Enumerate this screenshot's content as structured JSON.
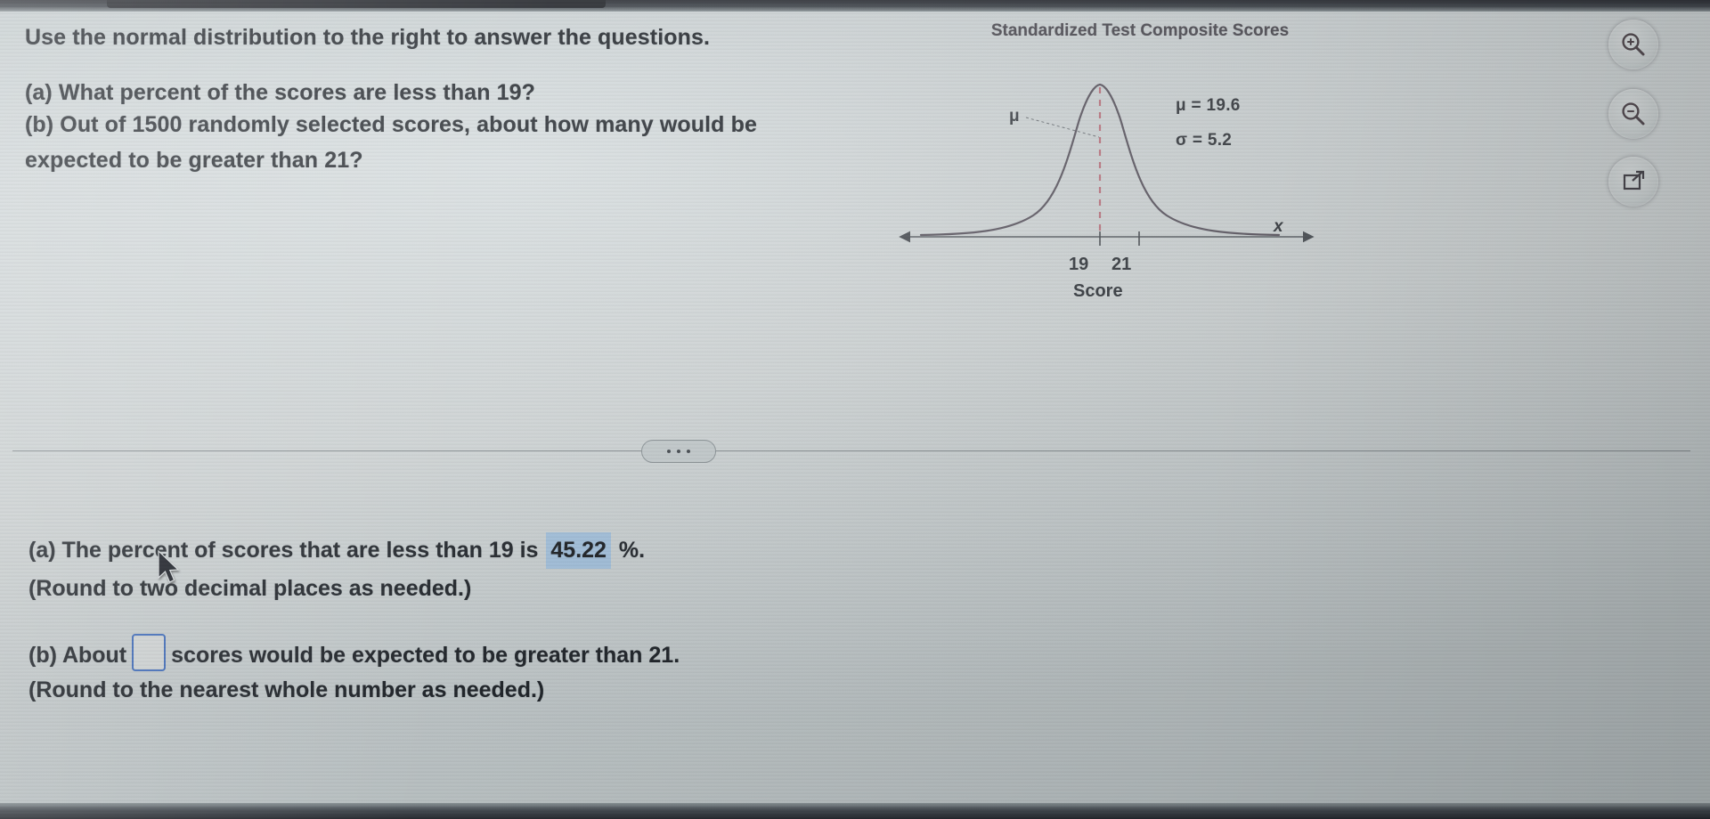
{
  "problem": {
    "stem": "Use the normal distribution to the right to answer the questions.",
    "part_a_question": "(a) What percent of the scores are less than 19?",
    "part_b_question": "(b) Out of 1500 randomly selected scores, about how many would be expected to be greater than 21?"
  },
  "figure": {
    "title": "Standardized Test Composite Scores",
    "mu_marker": "μ",
    "mu_label": "μ = 19.6",
    "sigma_label": "σ = 5.2",
    "tick_19": "19",
    "tick_21": "21",
    "x_axis_name": "Score",
    "x_axis_variable": "x",
    "curve_color": "#5a5560",
    "dashed_line_color": "#c0737f"
  },
  "toolbar": {
    "zoom_in_icon": "magnifier-plus-icon",
    "zoom_out_icon": "magnifier-minus-icon",
    "expand_icon": "pop-out-icon"
  },
  "divider": {
    "more_label": "…"
  },
  "answers": {
    "part_a_prefix": "(a) The percent of scores that are less than 19 is",
    "part_a_value": "45.22",
    "part_a_suffix": "%.",
    "part_a_note": "(Round to two decimal places as needed.)",
    "part_b_prefix": "(b) About",
    "part_b_value": "",
    "part_b_suffix": "scores would be expected to be greater than 21.",
    "part_b_note": "(Round to the nearest whole number as needed.)"
  },
  "chart_data": {
    "type": "line",
    "title": "Standardized Test Composite Scores",
    "xlabel": "Score",
    "ylabel": "",
    "distribution": "normal",
    "mu": 19.6,
    "sigma": 5.2,
    "annotations": [
      {
        "text": "μ = 19.6",
        "type": "parameter"
      },
      {
        "text": "σ = 5.2",
        "type": "parameter"
      },
      {
        "text": "μ",
        "type": "mean-pointer"
      }
    ],
    "tick_labels": [
      "19",
      "21"
    ],
    "tick_values": [
      19,
      21
    ],
    "vertical_reference_line": {
      "x": 19,
      "style": "dashed",
      "color": "#c0737f"
    },
    "axis_arrows": [
      "left",
      "right"
    ],
    "grid": false,
    "legend": "none",
    "x": [
      4.0,
      5.6,
      7.2,
      8.8,
      10.4,
      12.0,
      13.6,
      15.2,
      16.8,
      18.4,
      19.6,
      20.8,
      22.4,
      24.0,
      25.6,
      27.2,
      28.8,
      30.4,
      32.0,
      33.6,
      35.2
    ],
    "y": [
      0.011,
      0.022,
      0.04,
      0.068,
      0.107,
      0.158,
      0.218,
      0.283,
      0.345,
      0.394,
      0.406,
      0.394,
      0.345,
      0.283,
      0.218,
      0.158,
      0.107,
      0.068,
      0.04,
      0.022,
      0.011
    ]
  }
}
